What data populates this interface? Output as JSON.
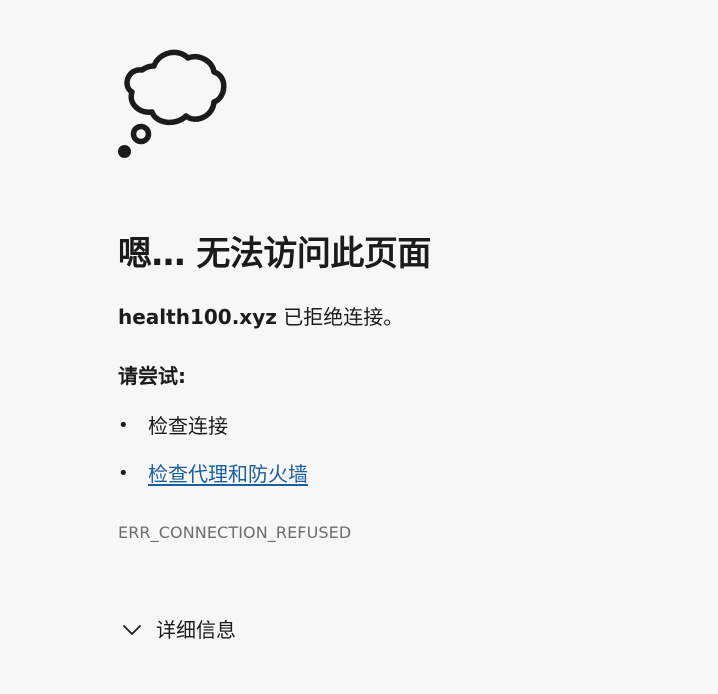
{
  "icon": "thought-bubble-icon",
  "title": "嗯… 无法访问此页面",
  "description": {
    "host": "health100.xyz",
    "message": " 已拒绝连接。"
  },
  "try_heading": "请尝试:",
  "suggestions": [
    {
      "label": "检查连接",
      "is_link": false
    },
    {
      "label": "检查代理和防火墙",
      "is_link": true
    }
  ],
  "bullet": "•",
  "error_code": "ERR_CONNECTION_REFUSED",
  "details": {
    "icon": "chevron-down-icon",
    "label": "详细信息"
  },
  "colors": {
    "background": "#f7f7f7",
    "text": "#1b1b1b",
    "link": "#1a5f9e",
    "error_code": "#6e6e6e"
  }
}
